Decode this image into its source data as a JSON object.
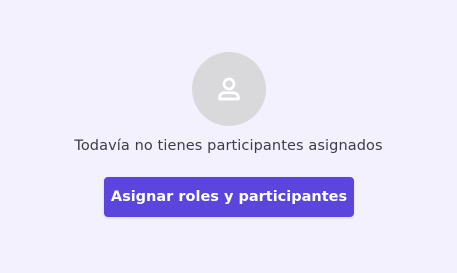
{
  "empty_state": {
    "icon": "user-icon",
    "message": "Todavía no tienes participantes asignados",
    "button_label": "Asignar roles y participantes"
  },
  "colors": {
    "background": "#f3f1fd",
    "avatar_background": "#d9d9dc",
    "icon": "#ffffff",
    "text": "#3d3d47",
    "button_background": "#5b45dc",
    "button_text": "#ffffff"
  }
}
